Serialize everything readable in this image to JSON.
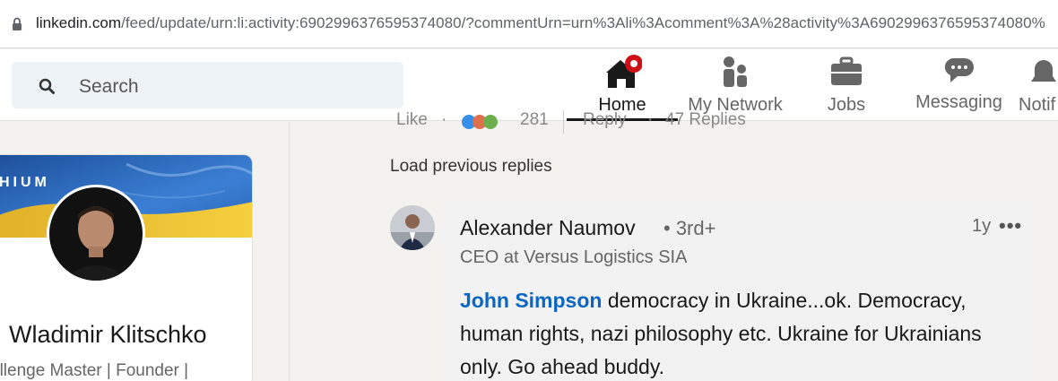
{
  "browser": {
    "url_host": "linkedin.com",
    "url_path": "/feed/update/urn:li:activity:6902996376595374080/?commentUrn=urn%3Ali%3Acomment%3A%28activity%3A6902996376595374080%"
  },
  "header": {
    "search_placeholder": "Search",
    "nav": [
      {
        "label": "Home",
        "icon": "home-icon"
      },
      {
        "label": "My Network",
        "icon": "people-icon"
      },
      {
        "label": "Jobs",
        "icon": "briefcase-icon"
      },
      {
        "label": "Messaging",
        "icon": "messaging-icon"
      },
      {
        "label": "Notif",
        "icon": "bell-icon"
      }
    ]
  },
  "profile_card": {
    "badge": "PREMIUM",
    "badge_visible": "HIUM",
    "name": "Wladimir Klitschko",
    "tagline": "allenge Master | Founder |"
  },
  "feed": {
    "actions": {
      "like": "Like",
      "reaction_count": "281",
      "reply": "Reply",
      "replies": "47 Replies"
    },
    "load_previous": "Load previous replies",
    "comment": {
      "author": "Alexander Naumov",
      "degree": "• 3rd+",
      "time": "1y",
      "menu": "•••",
      "headline": "CEO at Versus Logistics SIA",
      "mention": "John Simpson",
      "text": " democracy in Ukraine...ok. Democracy, human rights, nazi philosophy etc. Ukraine for Ukrainians only. Go ahead buddy."
    }
  },
  "colors": {
    "linkedin_blue": "#0a66c2",
    "notification_red": "#cc1016",
    "bg": "#f3f2ef"
  }
}
